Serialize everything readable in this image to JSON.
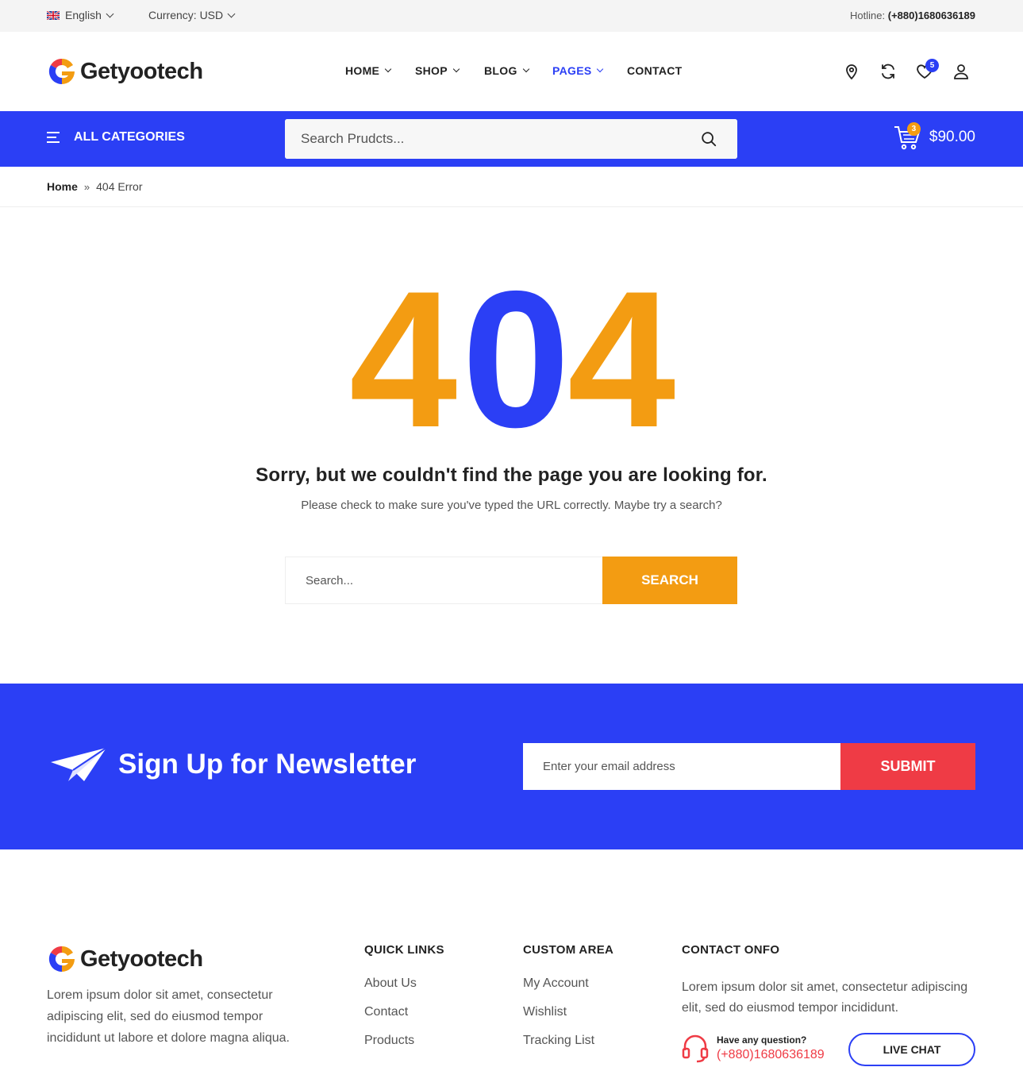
{
  "topbar": {
    "language": "English",
    "currency": "Currency: USD",
    "hotline_label": "Hotline:",
    "hotline_number": "(+880)1680636189"
  },
  "brand": {
    "name": "Getyootech"
  },
  "nav": {
    "items": [
      {
        "label": "HOME",
        "dropdown": true
      },
      {
        "label": "SHOP",
        "dropdown": true
      },
      {
        "label": "BLOG",
        "dropdown": true
      },
      {
        "label": "PAGES",
        "dropdown": true,
        "active": true
      },
      {
        "label": "CONTACT",
        "dropdown": false
      }
    ],
    "wishlist_count": "5"
  },
  "categories": {
    "label": "ALL CATEGORIES"
  },
  "search": {
    "placeholder": "Search Prudcts..."
  },
  "cart": {
    "count": "3",
    "total": "$90.00"
  },
  "breadcrumb": {
    "home": "Home",
    "current": "404 Error"
  },
  "error": {
    "code": "404",
    "title": "Sorry, but we couldn't find the page you are looking for.",
    "subtitle": "Please check to make sure you've typed the URL correctly. Maybe try a search?",
    "search_placeholder": "Search...",
    "search_button": "SEARCH"
  },
  "newsletter": {
    "title": "Sign Up for Newsletter",
    "email_placeholder": "Enter your email address",
    "submit": "SUBMIT"
  },
  "footer": {
    "description": "Lorem ipsum dolor sit amet, consectetur adipiscing elit, sed do eiusmod tempor incididunt ut labore et dolore magna aliqua.",
    "quick_links": {
      "title": "QUICK LINKS",
      "items": [
        "About Us",
        "Contact",
        "Products"
      ]
    },
    "custom_area": {
      "title": "CUSTOM AREA",
      "items": [
        "My Account",
        "Wishlist",
        "Tracking List"
      ]
    },
    "contact_info": {
      "title": "CONTACT ONFO",
      "text": "Lorem ipsum dolor sit amet, consectetur adipiscing elit, sed do eiusmod tempor incididunt.",
      "question": "Have any question?",
      "phone": "(+880)1680636189",
      "live_chat": "LIVE CHAT"
    }
  },
  "colors": {
    "primary": "#2b3ff5",
    "accent": "#f39c12",
    "danger": "#ef3b45"
  }
}
